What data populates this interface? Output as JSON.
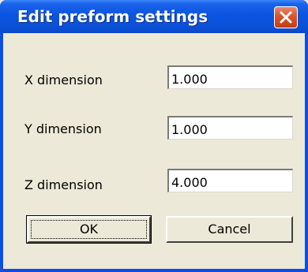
{
  "window": {
    "title": "Edit preform settings",
    "close_icon": "close-icon"
  },
  "fields": [
    {
      "label": "X dimension",
      "value": "1.000"
    },
    {
      "label": "Y dimension",
      "value": "1.000"
    },
    {
      "label": "Z dimension",
      "value": "4.000"
    }
  ],
  "buttons": {
    "ok_label": "OK",
    "cancel_label": "Cancel"
  },
  "colors": {
    "titlebar": "#0a55e0",
    "close_button": "#d9542c",
    "dialog_background": "#ece9d8"
  }
}
